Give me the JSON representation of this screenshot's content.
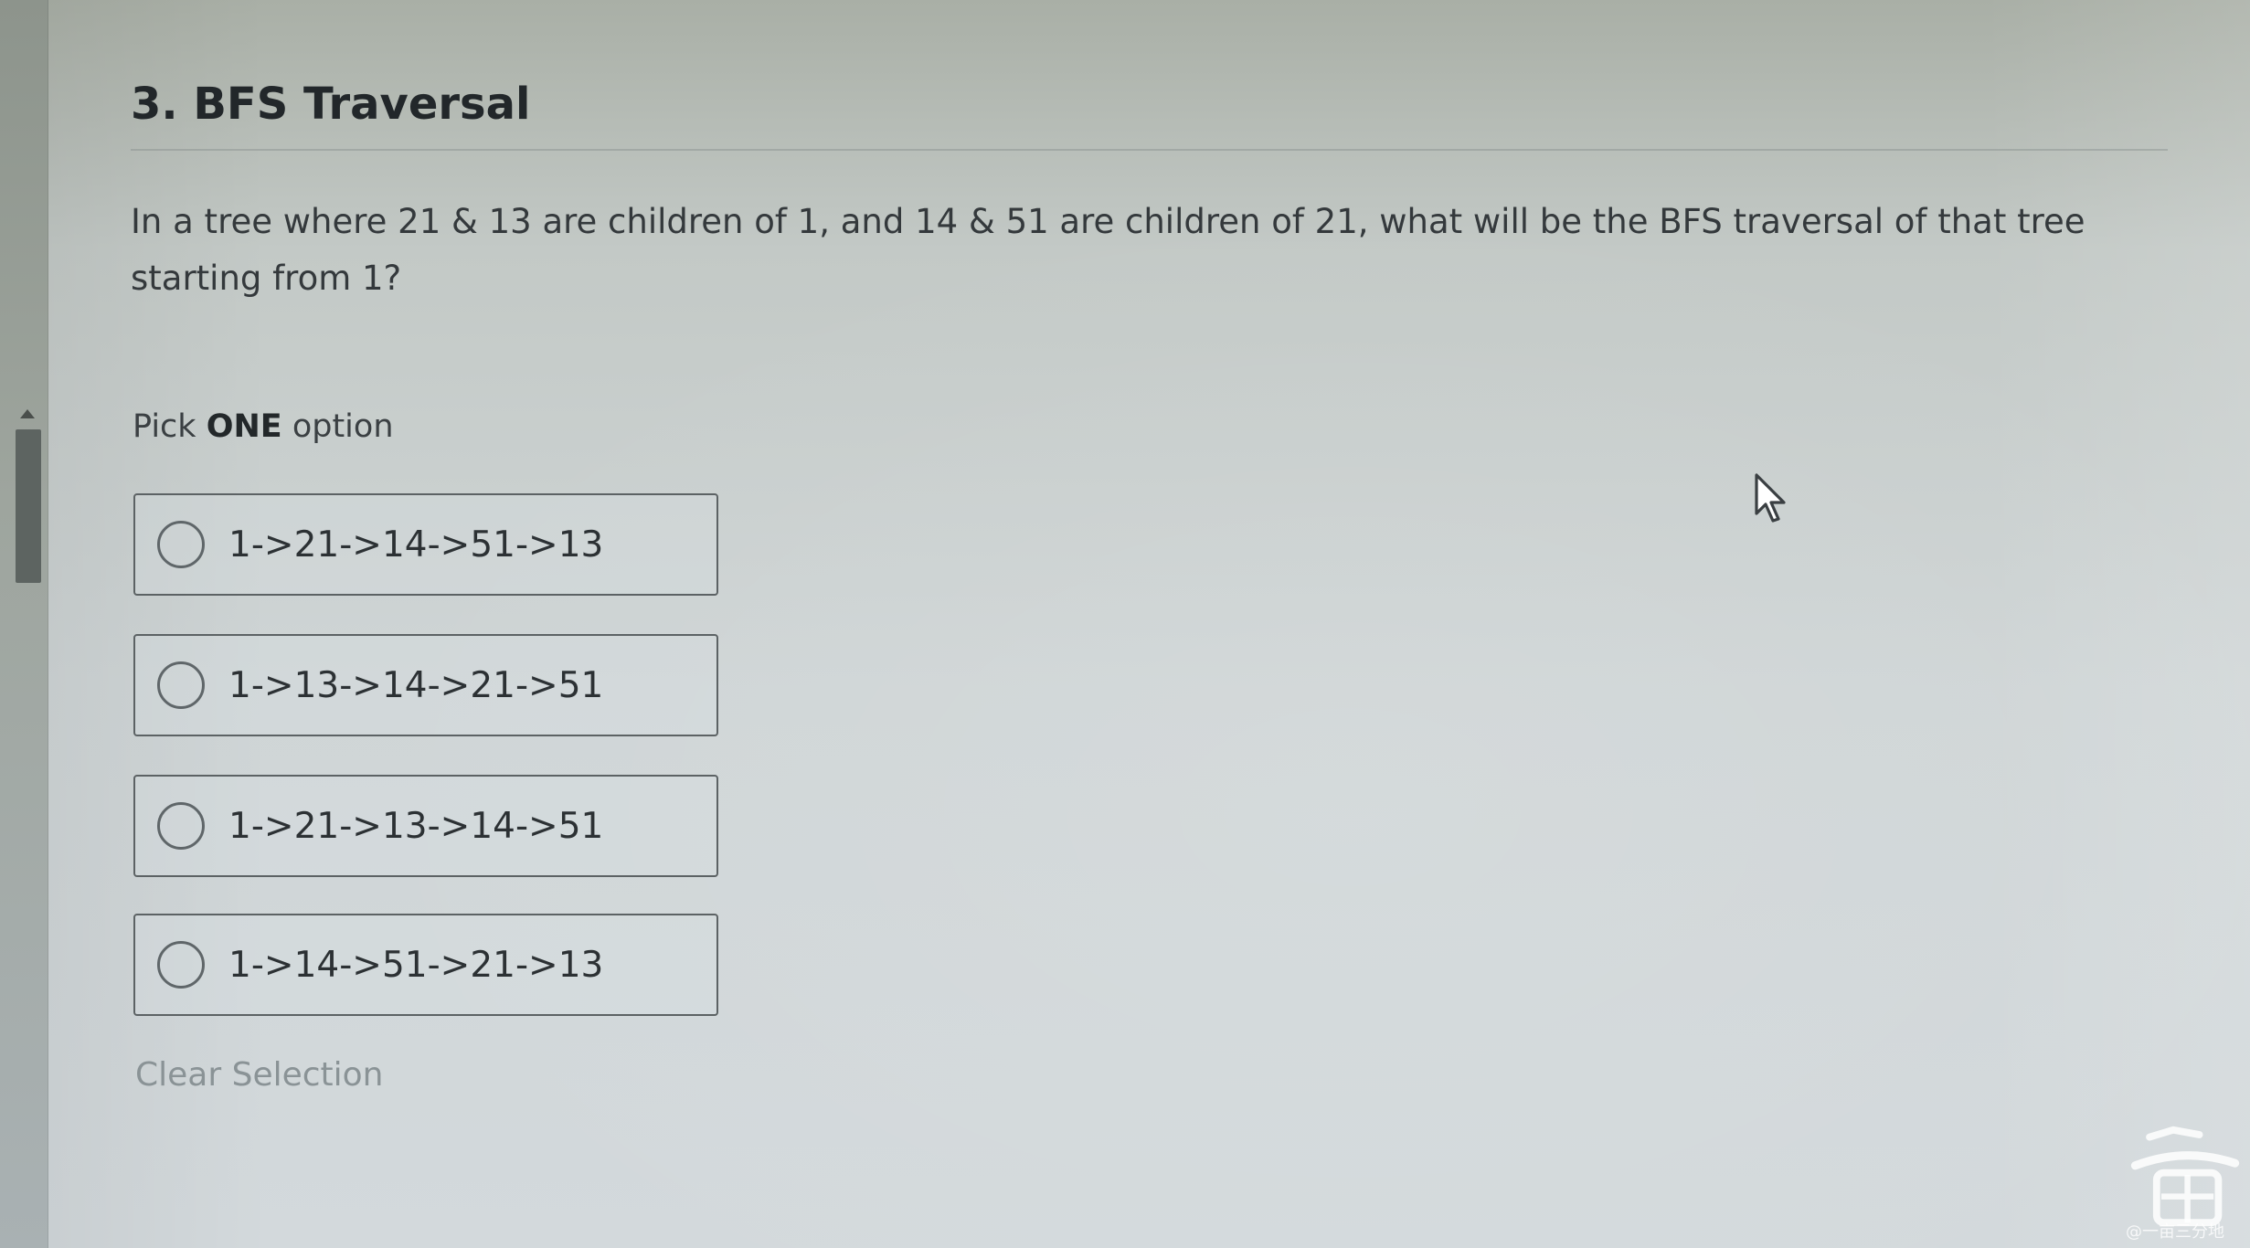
{
  "question": {
    "title": "3. BFS Traversal",
    "prompt": "In a tree where 21 & 13 are children of 1, and 14 & 51 are children of 21, what will be the BFS traversal of that tree starting from 1?"
  },
  "instructions": {
    "pick_prefix": "Pick",
    "pick_bold": "ONE",
    "pick_suffix": "option"
  },
  "options": [
    {
      "label": "1->21->14->51->13"
    },
    {
      "label": "1->13->14->21->51"
    },
    {
      "label": "1->21->13->14->51"
    },
    {
      "label": "1->14->51->21->13"
    }
  ],
  "clear_selection_label": "Clear Selection",
  "watermark": {
    "text": "@一亩三分地"
  },
  "icons": {
    "cursor": "mouse-pointer-icon",
    "scroll_up": "scroll-up-arrow-icon",
    "watermark": "yimu-sanfendi-logo"
  },
  "colors": {
    "title_text": "#22272a",
    "body_text": "#34393c",
    "option_border": "#5c6264",
    "clear_selection_text": "#8a9396",
    "scroll_thumb": "#5d6461"
  }
}
